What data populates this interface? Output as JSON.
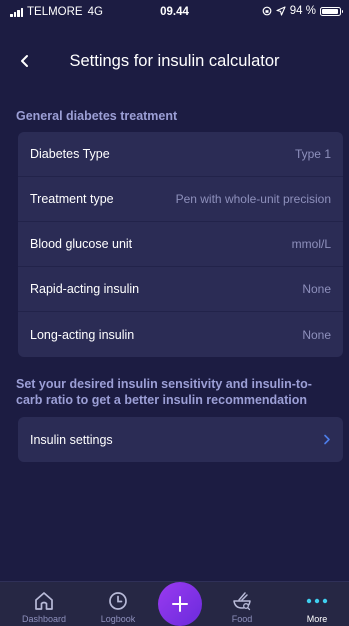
{
  "status_bar": {
    "carrier": "TELMORE",
    "network": "4G",
    "time": "09.44",
    "battery": "94 %",
    "battery_level": 0.94
  },
  "header": {
    "title": "Settings for insulin calculator"
  },
  "general_section": {
    "heading": "General diabetes treatment",
    "rows": [
      {
        "label": "Diabetes Type",
        "value": "Type 1"
      },
      {
        "label": "Treatment type",
        "value": "Pen with whole-unit precision"
      },
      {
        "label": "Blood glucose unit",
        "value": "mmol/L"
      },
      {
        "label": "Rapid-acting insulin",
        "value": "None"
      },
      {
        "label": "Long-acting insulin",
        "value": "None"
      }
    ]
  },
  "sensitivity_section": {
    "heading": "Set your desired insulin sensitivity and insulin-to-carb ratio to get a better insulin recommendation",
    "rows": [
      {
        "label": "Insulin settings"
      }
    ]
  },
  "tab_bar": {
    "tabs": [
      {
        "label": "Dashboard",
        "icon": "house-icon"
      },
      {
        "label": "Logbook",
        "icon": "clock-icon"
      },
      {
        "label": "Food",
        "icon": "food-bowl-icon"
      },
      {
        "label": "More",
        "icon": "more-dots-icon"
      }
    ],
    "add_icon": "plus-icon",
    "active": "More"
  },
  "colors": {
    "background": "#1c1c42",
    "card": "#2b2c55",
    "section_heading": "#9c9fd6",
    "value_text": "#8e90bc",
    "accent_blue": "#4d7de8",
    "add_button": "#8a35ea"
  }
}
